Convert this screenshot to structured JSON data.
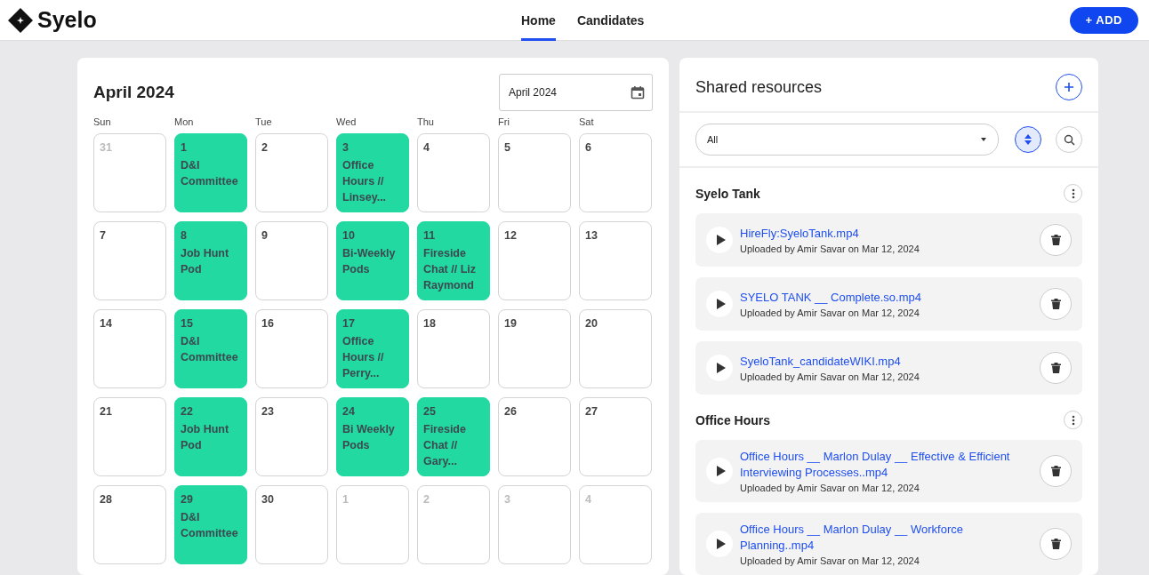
{
  "brand": {
    "name": "Syelo"
  },
  "nav": [
    {
      "label": "Home",
      "selected": true
    },
    {
      "label": "Candidates",
      "selected": false
    }
  ],
  "add_button": {
    "icon": "+",
    "label": "ADD"
  },
  "calendar": {
    "title": "April 2024",
    "month_field": {
      "value": "April 2024"
    },
    "weekdays": [
      "Sun",
      "Mon",
      "Tue",
      "Wed",
      "Thu",
      "Fri",
      "Sat"
    ],
    "days": [
      {
        "day": "31",
        "outside": true
      },
      {
        "day": "1",
        "outside": false,
        "event": "D&I Committee"
      },
      {
        "day": "2",
        "outside": false
      },
      {
        "day": "3",
        "outside": false,
        "event": "Office Hours // Linsey..."
      },
      {
        "day": "4",
        "outside": false
      },
      {
        "day": "5",
        "outside": false
      },
      {
        "day": "6",
        "outside": false
      },
      {
        "day": "7",
        "outside": false
      },
      {
        "day": "8",
        "outside": false,
        "event": "Job Hunt Pod"
      },
      {
        "day": "9",
        "outside": false
      },
      {
        "day": "10",
        "outside": false,
        "event": "Bi-Weekly Pods"
      },
      {
        "day": "11",
        "outside": false,
        "event": "Fireside Chat // Liz Raymond"
      },
      {
        "day": "12",
        "outside": false
      },
      {
        "day": "13",
        "outside": false
      },
      {
        "day": "14",
        "outside": false
      },
      {
        "day": "15",
        "outside": false,
        "event": "D&I Committee"
      },
      {
        "day": "16",
        "outside": false
      },
      {
        "day": "17",
        "outside": false,
        "event": "Office Hours // Perry..."
      },
      {
        "day": "18",
        "outside": false
      },
      {
        "day": "19",
        "outside": false
      },
      {
        "day": "20",
        "outside": false
      },
      {
        "day": "21",
        "outside": false
      },
      {
        "day": "22",
        "outside": false,
        "event": "Job Hunt Pod"
      },
      {
        "day": "23",
        "outside": false
      },
      {
        "day": "24",
        "outside": false,
        "event": "Bi Weekly Pods"
      },
      {
        "day": "25",
        "outside": false,
        "event": "Fireside Chat // Gary..."
      },
      {
        "day": "26",
        "outside": false
      },
      {
        "day": "27",
        "outside": false
      },
      {
        "day": "28",
        "outside": false
      },
      {
        "day": "29",
        "outside": false,
        "event": "D&I Committee"
      },
      {
        "day": "30",
        "outside": false
      },
      {
        "day": "1",
        "outside": true
      },
      {
        "day": "2",
        "outside": true
      },
      {
        "day": "3",
        "outside": true
      },
      {
        "day": "4",
        "outside": true
      }
    ]
  },
  "resources": {
    "title": "Shared resources",
    "filter": {
      "value": "All"
    },
    "groups": [
      {
        "name": "Syelo Tank",
        "items": [
          {
            "title": "HireFly:SyeloTank.mp4",
            "meta": "Uploaded by Amir Savar on Mar 12, 2024"
          },
          {
            "title": "SYELO TANK __ Complete.so.mp4",
            "meta": "Uploaded by Amir Savar on Mar 12, 2024"
          },
          {
            "title": "SyeloTank_candidateWIKI.mp4",
            "meta": "Uploaded by Amir Savar on Mar 12, 2024"
          }
        ]
      },
      {
        "name": "Office Hours",
        "items": [
          {
            "title": "Office Hours __ Marlon Dulay __ Effective & Efficient Interviewing Processes..mp4",
            "meta": "Uploaded by Amir Savar on Mar 12, 2024"
          },
          {
            "title": "Office Hours __ Marlon Dulay __ Workforce Planning..mp4",
            "meta": "Uploaded by Amir Savar on Mar 12, 2024"
          }
        ]
      }
    ]
  }
}
